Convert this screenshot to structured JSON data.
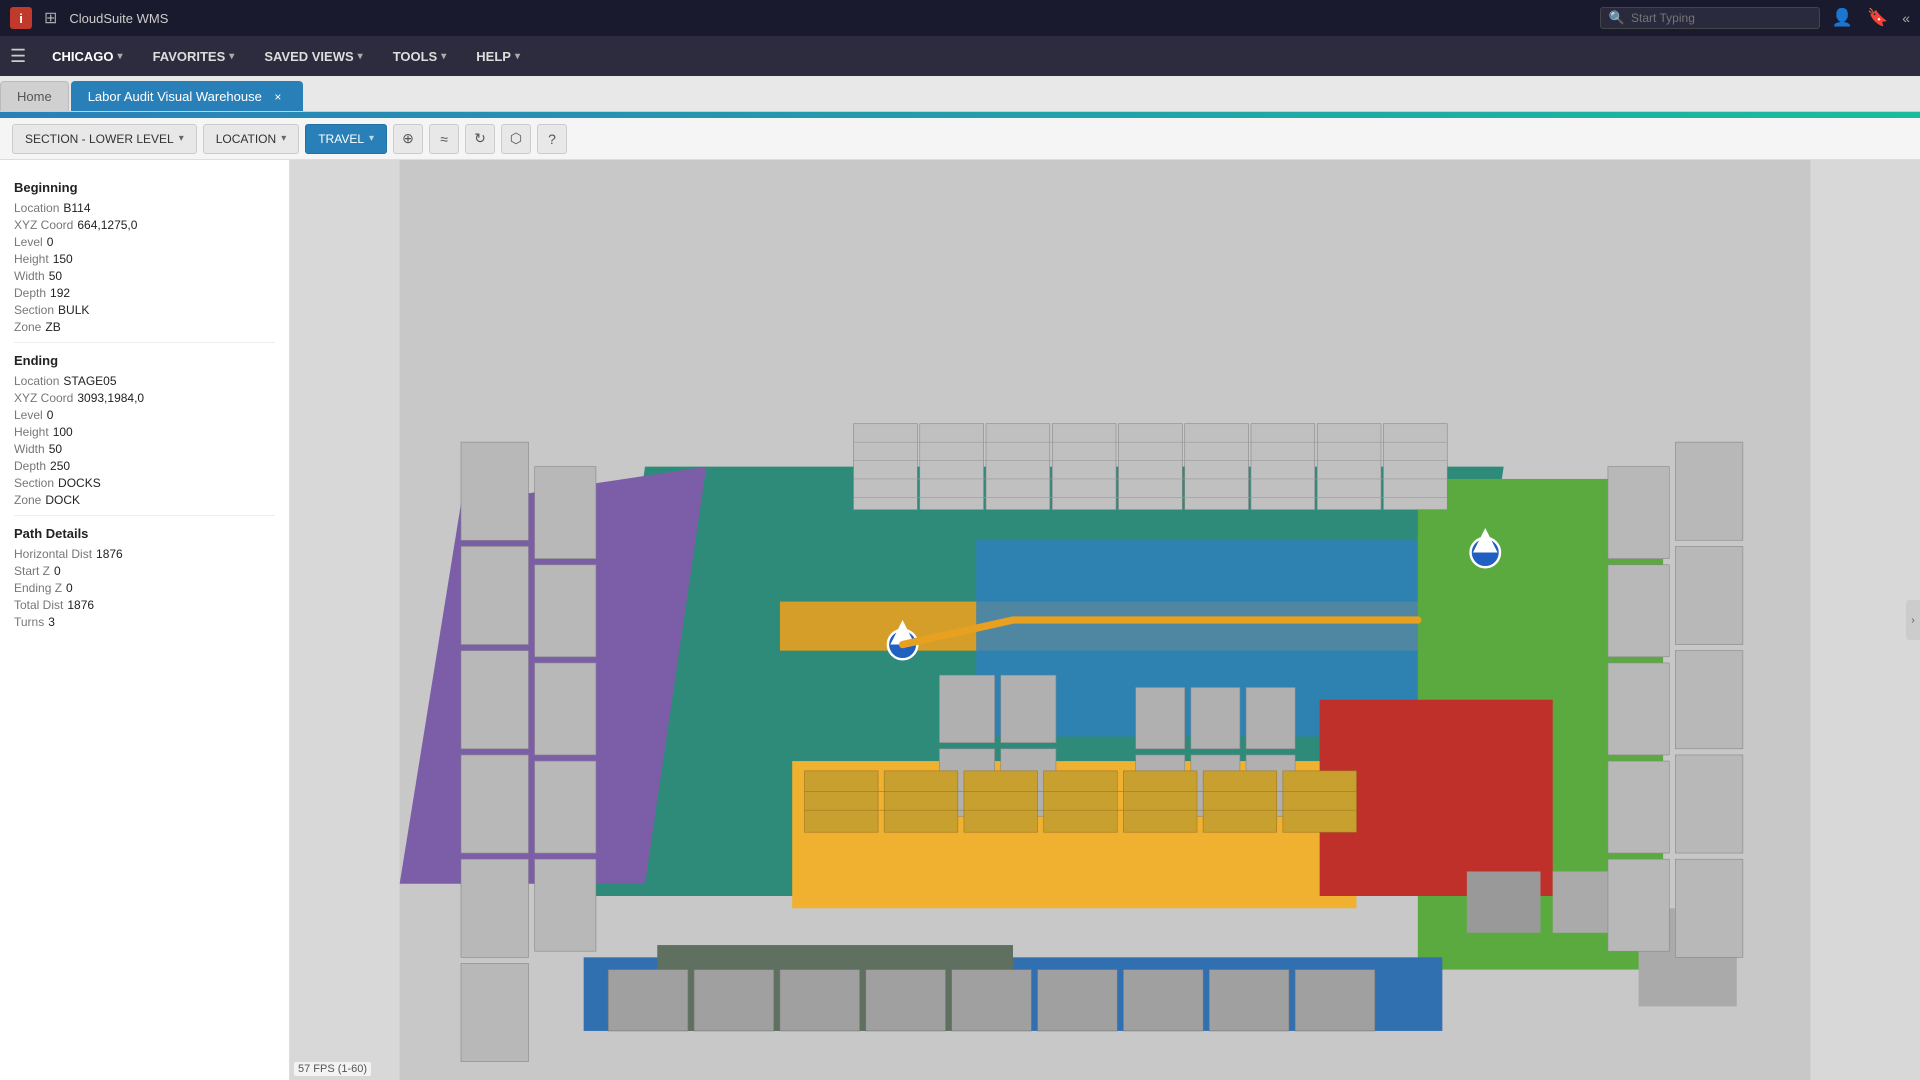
{
  "topbar": {
    "logo_text": "i",
    "app_title": "CloudSuite WMS",
    "search_placeholder": "Start Typing"
  },
  "navbar": {
    "chicago_label": "CHICAGO",
    "favorites_label": "FAVORITES",
    "saved_views_label": "SAVED VIEWS",
    "tools_label": "TOOLS",
    "help_label": "HELP"
  },
  "tabs": {
    "home_label": "Home",
    "active_label": "Labor Audit Visual Warehouse",
    "close_label": "×"
  },
  "toolbar": {
    "section_label": "SECTION - LOWER LEVEL",
    "location_label": "LOCATION",
    "travel_label": "TRAVEL"
  },
  "left_panel": {
    "beginning_title": "Beginning",
    "location_label": "Location",
    "location_value": "B114",
    "xyz_label": "XYZ Coord",
    "xyz_value": "664,1275,0",
    "level_label": "Level",
    "level_value": "0",
    "height_label": "Height",
    "height_value": "150",
    "width_label": "Width",
    "width_value": "50",
    "depth_label": "Depth",
    "depth_value": "192",
    "section_label": "Section",
    "section_value": "BULK",
    "zone_label": "Zone",
    "zone_value": "ZB",
    "ending_title": "Ending",
    "end_location_label": "Location",
    "end_location_value": "STAGE05",
    "end_xyz_label": "XYZ Coord",
    "end_xyz_value": "3093,1984,0",
    "end_level_label": "Level",
    "end_level_value": "0",
    "end_height_label": "Height",
    "end_height_value": "100",
    "end_width_label": "Width",
    "end_width_value": "50",
    "end_depth_label": "Depth",
    "end_depth_value": "250",
    "end_section_label": "Section",
    "end_section_value": "DOCKS",
    "end_zone_label": "Zone",
    "end_zone_value": "DOCK",
    "path_title": "Path Details",
    "horiz_dist_label": "Horizontal Dist",
    "horiz_dist_value": "1876",
    "start_z_label": "Start Z",
    "start_z_value": "0",
    "ending_z_label": "Ending Z",
    "ending_z_value": "0",
    "total_dist_label": "Total Dist",
    "total_dist_value": "1876",
    "turns_label": "Turns",
    "turns_value": "3"
  },
  "fps": {
    "label": "57 FPS (1-60)"
  },
  "icons": {
    "grid": "⊞",
    "search": "🔍",
    "user": "👤",
    "bookmark": "🔖",
    "collapse": "«",
    "refresh": "↻",
    "external": "⬡",
    "help": "?",
    "cursor": "⊕",
    "route": "≈"
  }
}
